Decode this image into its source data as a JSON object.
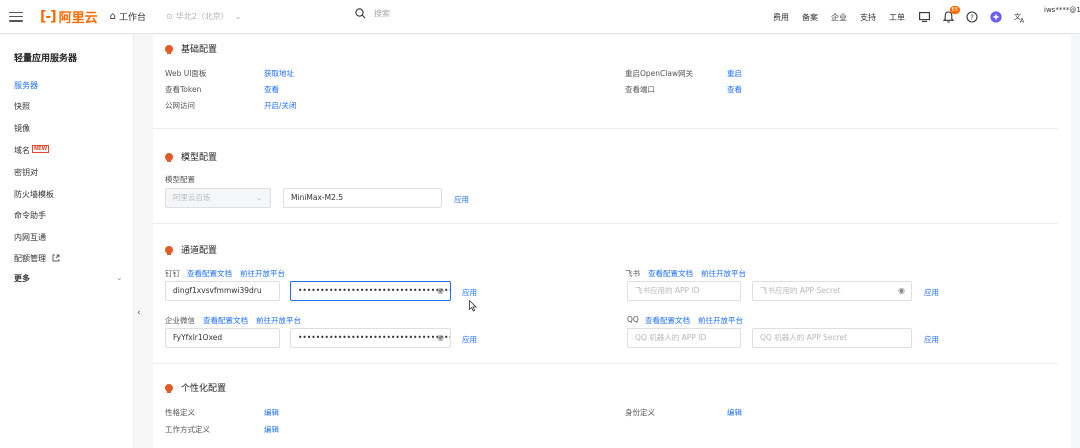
{
  "topbar": {
    "logo_text": "阿里云",
    "workbench": "工作台",
    "region": "华北2（北京）",
    "search_placeholder": "搜索",
    "nav": [
      "费用",
      "备案",
      "企业",
      "支持",
      "工单"
    ],
    "notification_count": "65",
    "user": "iws****@1"
  },
  "sidebar": {
    "title": "轻量应用服务器",
    "items": [
      "服务器",
      "快照",
      "镜像",
      "域名",
      "密钥对",
      "防火墙模板",
      "命令助手",
      "内网互通",
      "配额管理",
      "更多"
    ],
    "new_badge": "NEW"
  },
  "basic": {
    "title": "基础配置",
    "web_ui_label": "Web UI面板",
    "web_ui_link": "获取地址",
    "token_label": "查看Token",
    "token_link": "查看",
    "public_label": "公网访问",
    "public_link": "开启/关闭",
    "restart_label": "重启OpenClaw网关",
    "restart_link": "重启",
    "port_label": "查看端口",
    "port_link": "查看"
  },
  "model": {
    "title": "模型配置",
    "label": "模型配置",
    "provider": "阿里云百炼",
    "model_value": "MiniMax-M2.5",
    "apply": "应用"
  },
  "channel": {
    "title": "通道配置",
    "dingtalk": "钉钉",
    "dingtalk_doc": "查看配置文档",
    "dingtalk_open": "前往开放平台",
    "dingtalk_id": "dingf1xvsvfmmwi39dru",
    "dingtalk_secret": "••••••••••••••••••••••••••••••••••••••••••",
    "apply": "应用",
    "feishu": "飞书",
    "feishu_doc": "查看配置文档",
    "feishu_open": "前往开放平台",
    "feishu_id_ph": "飞书应用的 APP ID",
    "feishu_secret_ph": "飞书应用的 APP Secret",
    "wecom": "企业微信",
    "wecom_doc": "查看配置文档",
    "wecom_open": "前往开放平台",
    "wecom_id": "FyYfxlr1Oxed",
    "wecom_secret": "••••••••••••••••••••••••••••••••••••••••",
    "qq": "QQ",
    "qq_doc": "查看配置文档",
    "qq_open": "前往开放平台",
    "qq_id_ph": "QQ 机器人的 APP ID",
    "qq_secret_ph": "QQ 机器人的 APP Secret"
  },
  "personal": {
    "title": "个性化配置",
    "personality_label": "性格定义",
    "personality_link": "编辑",
    "identity_label": "身份定义",
    "identity_link": "编辑",
    "workstyle_label": "工作方式定义",
    "workstyle_link": "编辑"
  },
  "colors": {
    "accent": "#1f6fff",
    "brand": "#ff6a00",
    "section_icon": "#e45b2a"
  }
}
